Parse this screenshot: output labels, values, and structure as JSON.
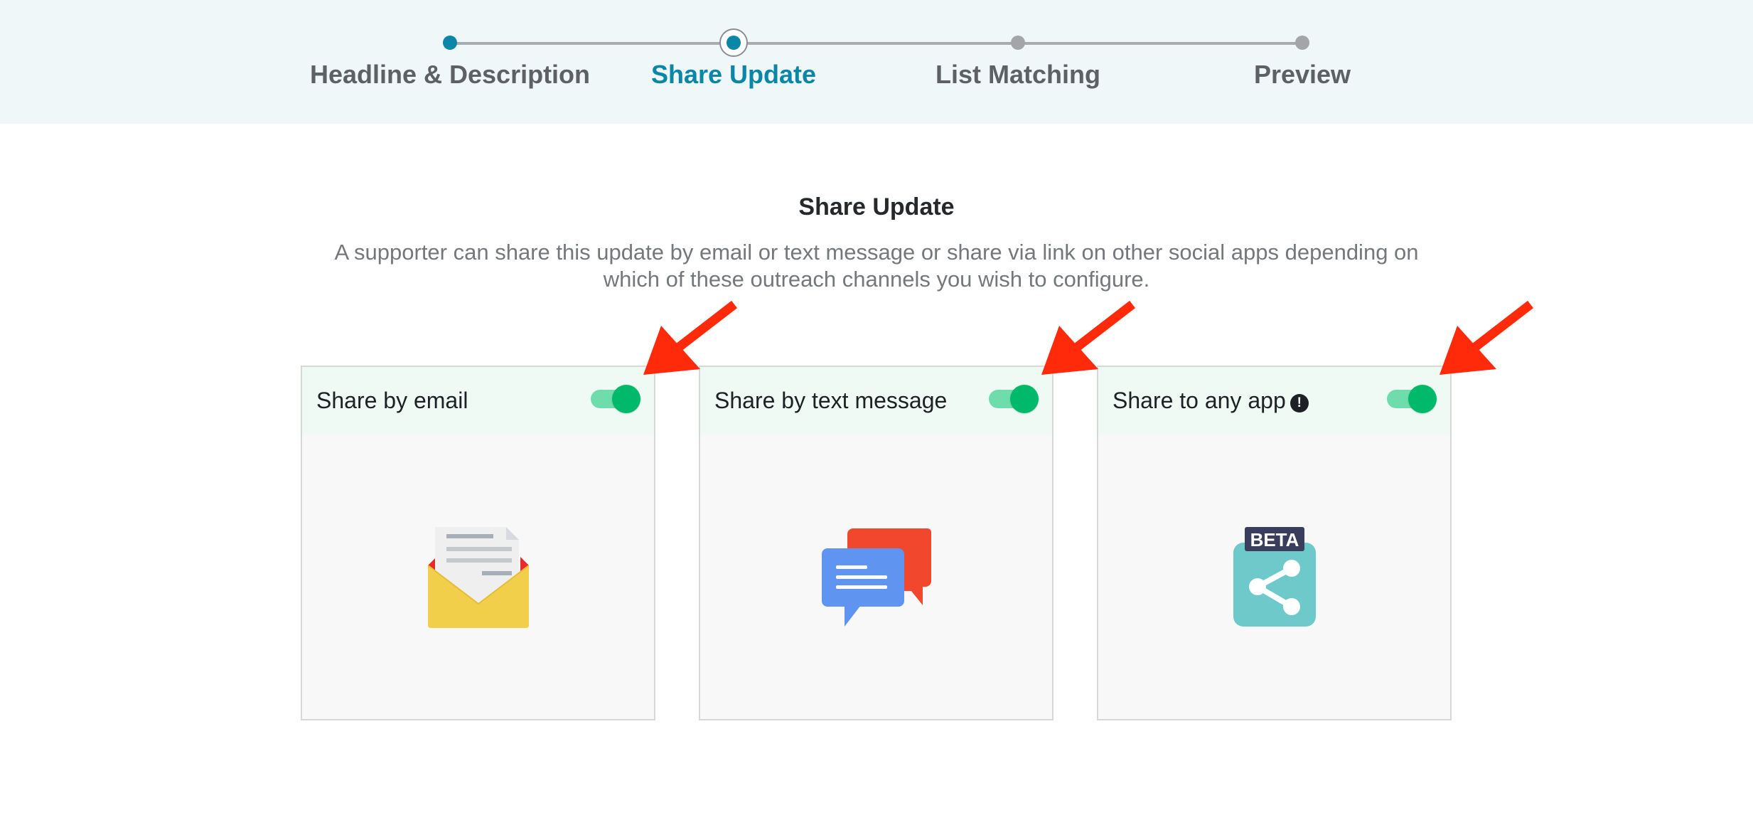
{
  "stepper": {
    "steps": [
      {
        "label": "Headline & Description",
        "state": "done"
      },
      {
        "label": "Share Update",
        "state": "active"
      },
      {
        "label": "List Matching",
        "state": "todo"
      },
      {
        "label": "Preview",
        "state": "todo"
      }
    ]
  },
  "main": {
    "title": "Share Update",
    "description": "A supporter can share this update by email or text message or share via link on other social apps depending on which of these outreach channels you wish to configure."
  },
  "cards": [
    {
      "title": "Share by email",
      "enabled": true,
      "icon": "envelope-icon"
    },
    {
      "title": "Share by text message",
      "enabled": true,
      "icon": "chat-bubbles-icon"
    },
    {
      "title": "Share to any app",
      "enabled": true,
      "icon": "share-icon",
      "info_icon": "!",
      "badge": "BETA"
    }
  ],
  "colors": {
    "accent": "#0a87a8",
    "toggle_on": "#00b96b",
    "toggle_track": "#6fdcab",
    "arrow": "#ff2a0a"
  }
}
